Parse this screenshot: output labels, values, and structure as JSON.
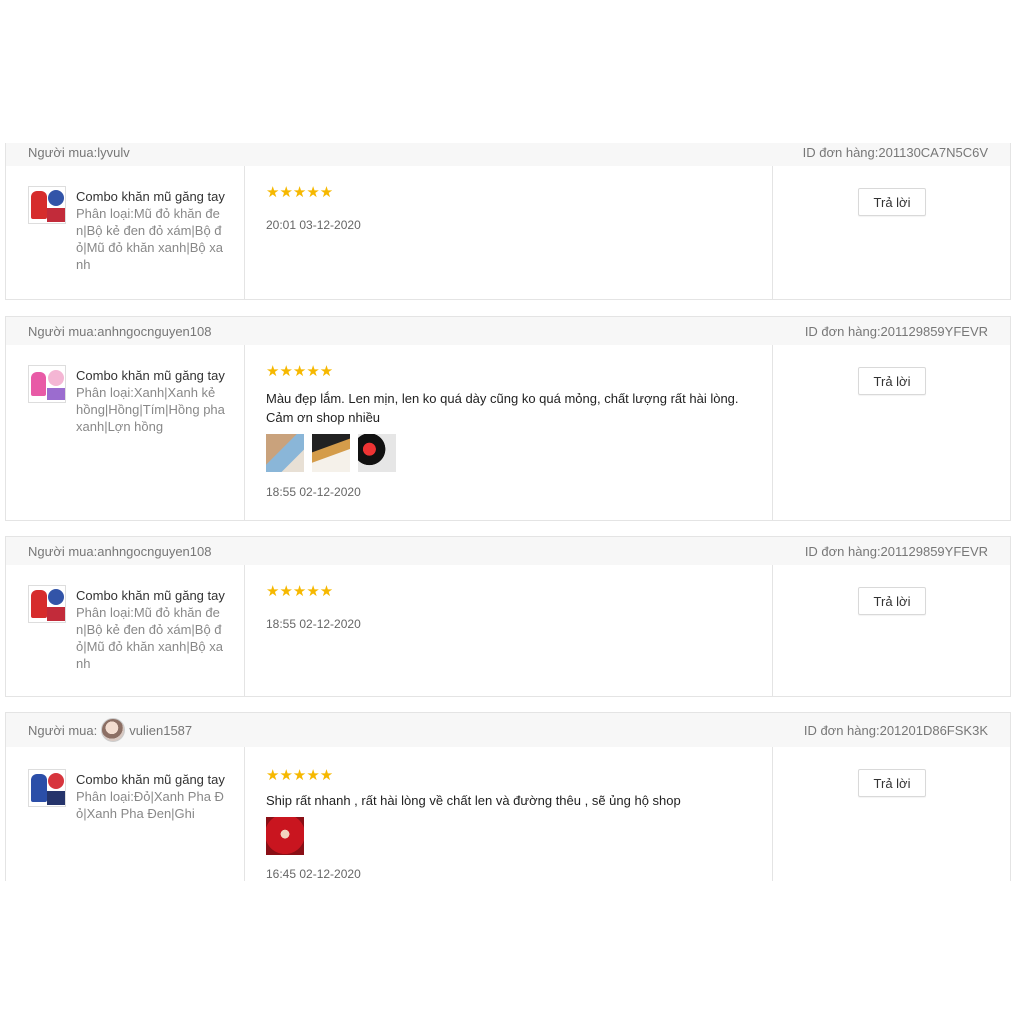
{
  "reviews": [
    {
      "buyer_label": "Người mua:",
      "buyer_name": "lyvulv",
      "order_id": "ID đơn hàng:201130CA7N5C6V",
      "product_name": "Combo khăn mũ găng tay",
      "variation": "Phân loại:Mũ đỏ khăn đen|Bộ kẻ đen đỏ xám|Bộ đỏ|Mũ đỏ khăn xanh|Bộ xanh",
      "rating": 5,
      "stars": "★★★★★",
      "comment": "",
      "time": "20:01 03-12-2020",
      "reply_label": "Trả lời"
    },
    {
      "buyer_label": "Người mua:",
      "buyer_name": "anhngocnguyen108",
      "order_id": "ID đơn hàng:201129859YFEVR",
      "product_name": "Combo khăn mũ găng tay",
      "variation": "Phân loại:Xanh|Xanh kẻ hồng|Hồng|Tím|Hồng pha xanh|Lợn hồng",
      "rating": 5,
      "stars": "★★★★★",
      "comment": "Màu đẹp lắm. Len mịn, len ko quá dày cũng ko quá mỏng, chất lượng rất hài lòng. Cảm ơn shop nhiều",
      "time": "18:55 02-12-2020",
      "reply_label": "Trả lời"
    },
    {
      "buyer_label": "Người mua:",
      "buyer_name": "anhngocnguyen108",
      "order_id": "ID đơn hàng:201129859YFEVR",
      "product_name": "Combo khăn mũ găng tay",
      "variation": "Phân loại:Mũ đỏ khăn đen|Bộ kẻ đen đỏ xám|Bộ đỏ|Mũ đỏ khăn xanh|Bộ xanh",
      "rating": 5,
      "stars": "★★★★★",
      "comment": "",
      "time": "18:55 02-12-2020",
      "reply_label": "Trả lời"
    },
    {
      "buyer_label": "Người mua:",
      "buyer_name": "vulien1587",
      "order_id": "ID đơn hàng:201201D86FSK3K",
      "product_name": "Combo khăn mũ găng tay",
      "variation": "Phân loại:Đỏ|Xanh Pha Đỏ|Xanh Pha Đen|Ghi",
      "rating": 5,
      "stars": "★★★★★",
      "comment": "Ship rất nhanh , rất hài lòng về chất len và đường thêu , sẽ ủng hộ shop",
      "time": "16:45 02-12-2020",
      "reply_label": "Trả lời"
    }
  ],
  "colors": {
    "star": "#f6b800",
    "header_bg": "#f7f7f7",
    "border": "#e4e4e4",
    "muted_text": "#777777"
  }
}
